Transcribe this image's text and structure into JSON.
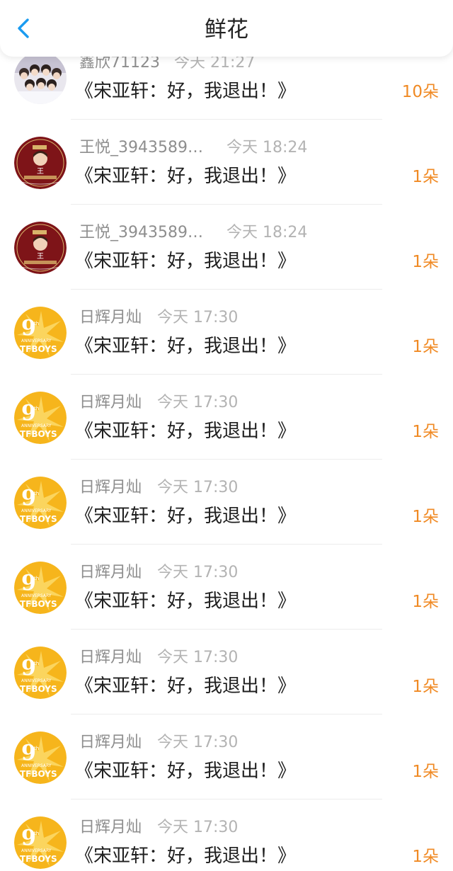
{
  "header": {
    "title": "鲜花",
    "back_icon": "chevron-left-icon",
    "accent_color": "#1a9bf0"
  },
  "colors": {
    "count": "#f08a24",
    "title": "#1f1f1f",
    "meta": "#8e8e8e"
  },
  "items": [
    {
      "name": "鑫欣71123",
      "time": "今天 21:27",
      "title": "《宋亚轩：好，我退出！》",
      "count": "10朵",
      "avatar": "boy-group-photo"
    },
    {
      "name": "王悦_39435898...",
      "time": "今天 18:24",
      "title": "《宋亚轩：好，我退出！》",
      "count": "1朵",
      "avatar": "red-badge-wang"
    },
    {
      "name": "王悦_39435898...",
      "time": "今天 18:24",
      "title": "《宋亚轩：好，我退出！》",
      "count": "1朵",
      "avatar": "red-badge-wang"
    },
    {
      "name": "日辉月灿",
      "time": "今天 17:30",
      "title": "《宋亚轩：好，我退出！》",
      "count": "1朵",
      "avatar": "tfboys-9th-anniversary"
    },
    {
      "name": "日辉月灿",
      "time": "今天 17:30",
      "title": "《宋亚轩：好，我退出！》",
      "count": "1朵",
      "avatar": "tfboys-9th-anniversary"
    },
    {
      "name": "日辉月灿",
      "time": "今天 17:30",
      "title": "《宋亚轩：好，我退出！》",
      "count": "1朵",
      "avatar": "tfboys-9th-anniversary"
    },
    {
      "name": "日辉月灿",
      "time": "今天 17:30",
      "title": "《宋亚轩：好，我退出！》",
      "count": "1朵",
      "avatar": "tfboys-9th-anniversary"
    },
    {
      "name": "日辉月灿",
      "time": "今天 17:30",
      "title": "《宋亚轩：好，我退出！》",
      "count": "1朵",
      "avatar": "tfboys-9th-anniversary"
    },
    {
      "name": "日辉月灿",
      "time": "今天 17:30",
      "title": "《宋亚轩：好，我退出！》",
      "count": "1朵",
      "avatar": "tfboys-9th-anniversary"
    },
    {
      "name": "日辉月灿",
      "time": "今天 17:30",
      "title": "《宋亚轩：好，我退出！》",
      "count": "1朵",
      "avatar": "tfboys-9th-anniversary"
    }
  ]
}
